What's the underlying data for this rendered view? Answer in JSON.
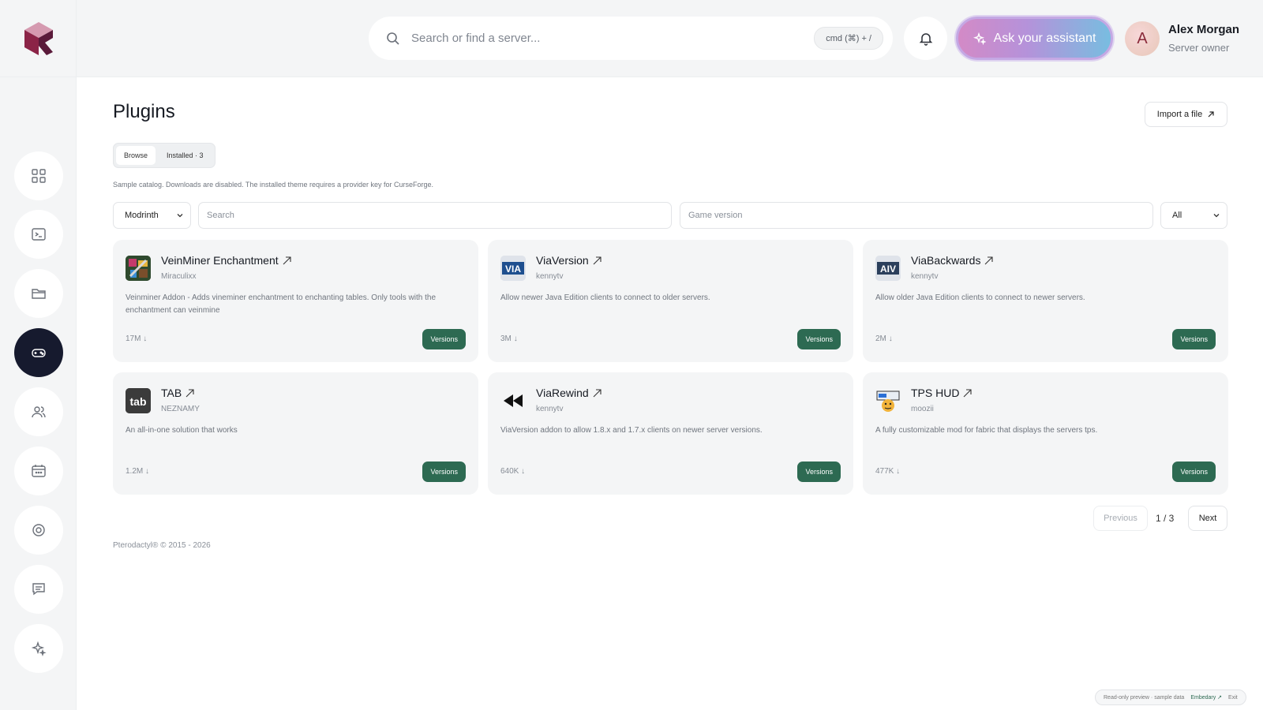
{
  "header": {
    "search_placeholder": "Search or find a server...",
    "shortcut": "cmd (⌘) + /",
    "assistant_label": "Ask your assistant",
    "user": {
      "initial": "A",
      "name": "Alex Morgan",
      "role": "Server owner"
    }
  },
  "sidebar": {
    "items": [
      {
        "icon": "dashboard-icon"
      },
      {
        "icon": "terminal-icon"
      },
      {
        "icon": "folder-icon"
      },
      {
        "icon": "gamepad-icon",
        "active": true
      },
      {
        "icon": "users-icon"
      },
      {
        "icon": "calendar-icon"
      },
      {
        "icon": "settings-icon"
      },
      {
        "icon": "chat-icon"
      },
      {
        "icon": "sparkles-icon"
      }
    ]
  },
  "main": {
    "title": "Plugins",
    "import_label": "Import a file",
    "tabs": [
      {
        "label": "Browse",
        "active": true
      },
      {
        "label": "Installed · 3"
      }
    ],
    "note": "Sample catalog. Downloads are disabled. The installed theme requires a provider key for CurseForge.",
    "filters": {
      "provider": "Modrinth",
      "search_placeholder": "Search",
      "version_placeholder": "Game version",
      "loader": "All"
    },
    "versions_label": "Versions",
    "plugins": [
      {
        "name": "VeinMiner Enchantment",
        "author": "Miraculixx",
        "description": "Veinminer Addon - Adds vineminer enchantment to enchanting tables. Only tools with the enchantment can veinmine",
        "downloads": "17M"
      },
      {
        "name": "ViaVersion",
        "author": "kennytv",
        "description": "Allow newer Java Edition clients to connect to older servers.",
        "downloads": "3M"
      },
      {
        "name": "ViaBackwards",
        "author": "kennytv",
        "description": "Allow older Java Edition clients to connect to newer servers.",
        "downloads": "2M"
      },
      {
        "name": "TAB",
        "author": "NEZNAMY",
        "description": "An all-in-one solution that works",
        "downloads": "1.2M"
      },
      {
        "name": "ViaRewind",
        "author": "kennytv",
        "description": "ViaVersion addon to allow 1.8.x and 1.7.x clients on newer server versions.",
        "downloads": "640K"
      },
      {
        "name": "TPS HUD",
        "author": "moozii",
        "description": "A fully customizable mod for fabric that displays the servers tps.",
        "downloads": "477K"
      }
    ],
    "pagination": {
      "previous": "Previous",
      "page": "1 / 3",
      "next": "Next"
    },
    "footer": "Pterodactyl® © 2015 - 2026"
  },
  "preview_bar": {
    "text": "Read-only preview · sample data",
    "link": "Embedary ↗",
    "exit": "Exit"
  },
  "colors": {
    "accent": "#2d6a52",
    "active_nav": "#161a2e"
  }
}
